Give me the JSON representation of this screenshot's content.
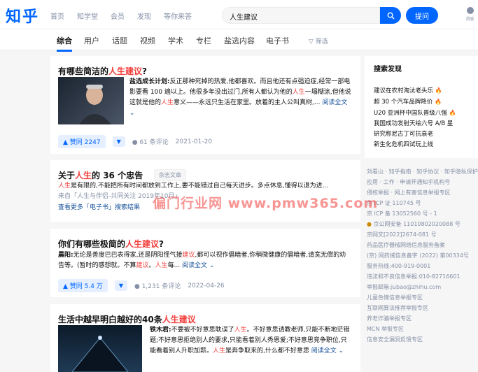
{
  "header": {
    "logo": "知乎",
    "nav": [
      "首页",
      "知学堂",
      "会员",
      "发现",
      "等你来答"
    ],
    "search_value": "人生建议",
    "ask_label": "提问",
    "user_label": "消息"
  },
  "tabs": {
    "items": [
      "综合",
      "用户",
      "话题",
      "视频",
      "学术",
      "专栏",
      "盐选内容",
      "电子书"
    ],
    "filter_label": "筛选"
  },
  "results": [
    {
      "title_pre": "有哪些简洁的",
      "title_hl": "人生建议",
      "title_post": "?",
      "author": "盐选成长计划:",
      "excerpt_a": "反正那种死掉的热爱,他都喜欢。而且他还有点强迫症,经常一部电影要看 100 遍以上。他很多年没出过门,所有人都认为他的",
      "excerpt_hl1": "人生",
      "excerpt_b": "一塌糊涂,但他说这就是他的",
      "excerpt_hl2": "人生",
      "excerpt_c": "意义——永远只生活在家里。放着的主人公叫真树,...",
      "read_more": "阅读全文",
      "vote": "▲ 赞同 2247",
      "comments": "61 条评论",
      "date": "2021-01-20"
    },
    {
      "title_pre": "关于",
      "title_hl": "人生",
      "title_post": "的 36 个忠告",
      "badge": "杂志文章",
      "line1_hl": "人生",
      "line1": "是有限的,不能把所有时间都放到工作上,要不能错过自己每天进步。多点休息,懂得以退为进...",
      "line2": "来自「人生与伴侣-共同关注 2019年10月」",
      "line3": "查看更多「电子书」搜索结果"
    },
    {
      "title_pre": "你们有哪些极简的",
      "title_hl": "人生建议",
      "title_post": "?",
      "author": "晨阳:",
      "excerpt_a": "无论是善度巴巴表得家,还是阴阳怪气接",
      "excerpt_hl1": "建议",
      "excerpt_b": ",都可以视作倡暗者,你稍微健康的倡暗者,请宽无偿的劝告等。(暂时的感想就。不算",
      "excerpt_hl2": "建议",
      "excerpt_c": "。",
      "excerpt_hl3": "人生",
      "excerpt_d": "每...",
      "read_more": "阅读全文",
      "vote": "▲ 赞同 5.4 万",
      "comments": "1,231 条评论",
      "date": "2022-04-26"
    },
    {
      "title_pre": "生活中越早明白越好的40条",
      "title_hl": "人生建议",
      "title_post": "",
      "author": "铁木君:",
      "excerpt_a": "不要被不好意思耽误了",
      "excerpt_hl1": "人生",
      "excerpt_b": "。不好意思请教老师,只能不断地茫错题;不好意思拒绝别人的要求,只能看着别人秀恩爱;不好意思竞争职位,只能看着别人升职加薪。",
      "excerpt_hl2": "人生",
      "excerpt_c": "是奔争取来的,什么都不好意思",
      "read_more": "阅读全文"
    }
  ],
  "sidebar": {
    "title": "搜索发现",
    "items": [
      {
        "text": "建议在农村淘汰老头乐",
        "hot": true
      },
      {
        "text": "超 30 个汽车品牌降价",
        "hot": true
      },
      {
        "text": "U20 亚洲杯中国队晋级八强",
        "hot": true
      },
      {
        "text": "我国成功发射天绘六号 A/B 星",
        "hot": false
      },
      {
        "text": "研究称尼古丁可抗衰老",
        "hot": false
      },
      {
        "text": "新生化危机四试玩上线",
        "hot": false
      }
    ]
  },
  "footer": [
    "刘看山 · 知乎指南 · 知乎协议 · 知乎隐私保护",
    "应用 · 工作 · 申请开通知乎机构号",
    "侵权举报 · 网上有害信息举报专区",
    "京 ICP 证 110745 号",
    "京 ICP 备 13052560 号 - 1",
    "京公网安备 11010802020088 号",
    "京网文[2022]2674-081 号",
    "药品医疗器械网络信息服务备案",
    "(京) 网药械信息备字 (2022) 第00334号",
    "服务热线:400-919-0001",
    "违法和不良信息举报:010-82716601",
    "举报邮箱:jubao@zhihu.com",
    "儿童色情信息举报专区",
    "互联网算法推荐举报专区",
    "养老诈骗举报专区",
    "MCN 举报专区",
    "信息安全漏洞反馈专区"
  ],
  "watermark": "偏门行业网 www.pmw365.com",
  "colors": {
    "brand": "#0066ff",
    "highlight": "#f1403c",
    "link": "#175199"
  }
}
